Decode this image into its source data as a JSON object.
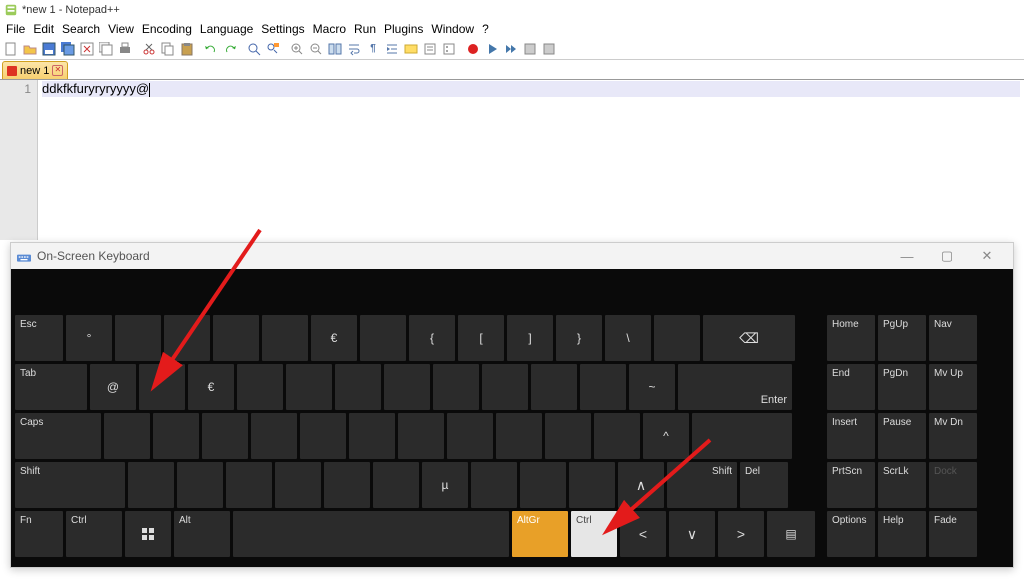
{
  "npp": {
    "title": "*new 1 - Notepad++",
    "menus": [
      "File",
      "Edit",
      "Search",
      "View",
      "Encoding",
      "Language",
      "Settings",
      "Macro",
      "Run",
      "Plugins",
      "Window",
      "?"
    ],
    "tab": {
      "name": "new 1"
    },
    "line_number": "1",
    "content": "ddkfkfuryryryyyy@"
  },
  "osk": {
    "title": "On-Screen Keyboard",
    "rows": {
      "r1": {
        "esc": "Esc",
        "euro": "€",
        "lbrace": "{",
        "lbrack": "[",
        "rbrack": "]",
        "rbrace": "}",
        "bslash": "\\",
        "bksp": "⌫"
      },
      "r2": {
        "tab": "Tab",
        "at": "@",
        "euro2": "€",
        "tilde": "~",
        "enter": "Enter"
      },
      "r3": {
        "caps": "Caps",
        "caret": "^"
      },
      "r4": {
        "shift": "Shift",
        "mu": "µ",
        "up": "∧",
        "shift_r": "Shift",
        "del": "Del"
      },
      "r5": {
        "fn": "Fn",
        "ctrl": "Ctrl",
        "alt": "Alt",
        "altgr": "AltGr",
        "ctrl_r": "Ctrl",
        "left": "<",
        "down": "∨",
        "right": ">",
        "menu": "▤"
      }
    },
    "nav": {
      "c1": [
        "Home",
        "End",
        "Insert",
        "PrtScn",
        "Options"
      ],
      "c2": [
        "PgUp",
        "PgDn",
        "Pause",
        "ScrLk",
        "Help"
      ],
      "c3": [
        "Nav",
        "Mv Up",
        "Mv Dn",
        "Dock",
        "Fade"
      ]
    }
  }
}
